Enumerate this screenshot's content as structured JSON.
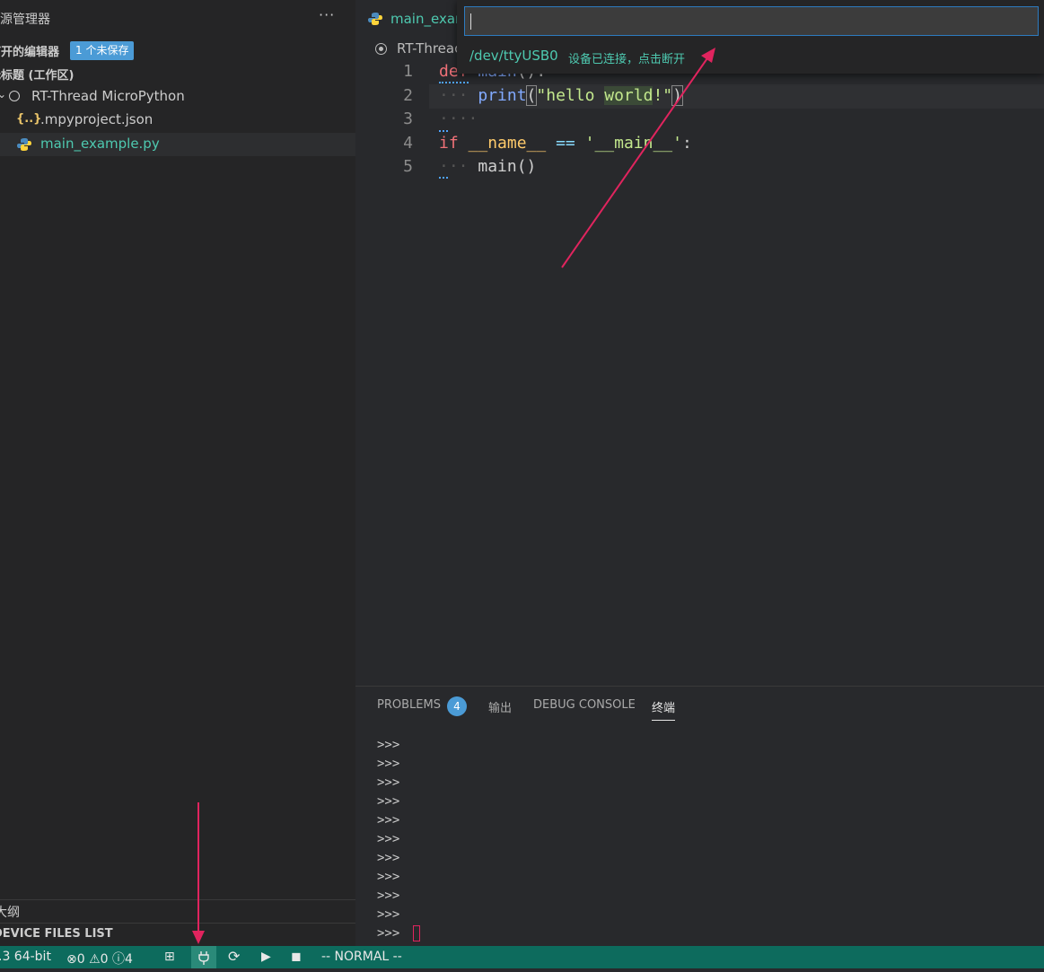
{
  "sidebar": {
    "title": "资源管理器",
    "more_label": "···",
    "open_editors_label": "打开的编辑器",
    "open_editors_badge": "1 个未保存",
    "workspace_label": "无标题 (工作区)",
    "tree": [
      {
        "label": "RT-Thread MicroPython",
        "icon": "folder-circle-icon"
      },
      {
        "label": ".mpyproject.json",
        "icon": "json-icon"
      },
      {
        "label": "main_example.py",
        "icon": "python-icon"
      }
    ],
    "outline_label": "大纲",
    "device_files_label": "DEVICE FILES LIST"
  },
  "editor": {
    "tab_label": "main_exar",
    "breadcrumb": "RT-Threac",
    "line_numbers": [
      "1",
      "2",
      "3",
      "4",
      "5"
    ]
  },
  "quickpick": {
    "input_value": "",
    "item_label": "/dev/ttyUSB0",
    "item_description": "设备已连接，点击断开"
  },
  "panel": {
    "tabs": [
      {
        "label": "PROBLEMS",
        "badge": "4"
      },
      {
        "label": "输出"
      },
      {
        "label": "DEBUG CONSOLE"
      },
      {
        "label": "终端"
      }
    ],
    "active_tab": "终端",
    "terminal_prompt": ">>>",
    "terminal_lines": [
      ">>>",
      ">>>",
      ">>>",
      ">>>",
      ">>>",
      ">>>",
      ">>>",
      ">>>",
      ">>>",
      ">>>",
      ">>>"
    ]
  },
  "statusbar": {
    "python_version": ".3 64-bit",
    "errors": "0",
    "warnings": "0",
    "infos": "4",
    "mode": "-- NORMAL --"
  },
  "colors": {
    "statusbar_bg": "#0d6b5d",
    "accent_teal": "#4ec9b0",
    "badge_blue": "#4b9bd6",
    "annotation_red": "#e0245e"
  }
}
